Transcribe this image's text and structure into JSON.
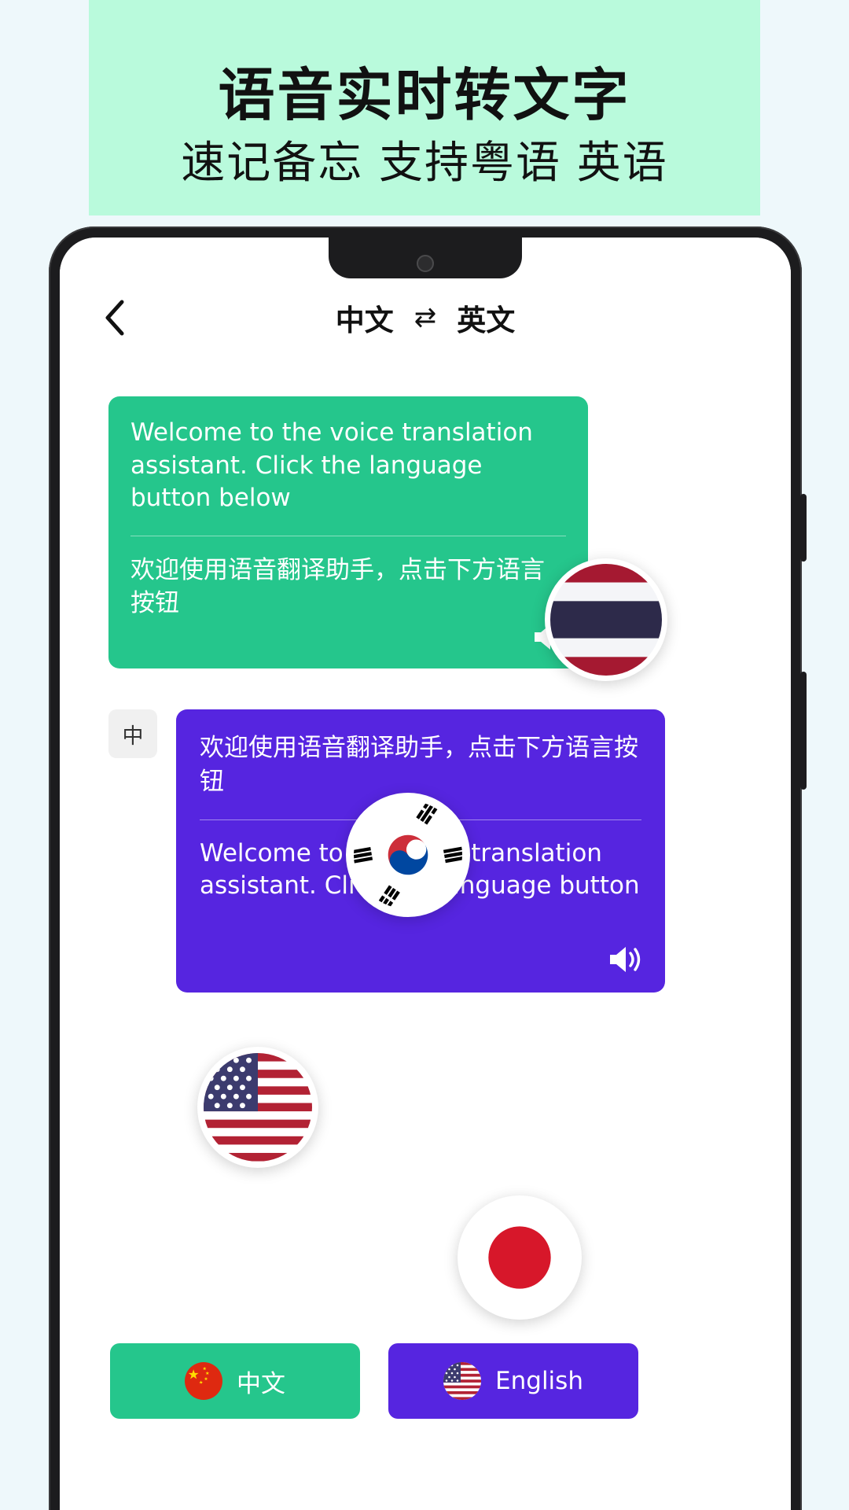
{
  "promo": {
    "title": "语音实时转文字",
    "subtitle": "速记备忘 支持粤语 英语"
  },
  "app": {
    "appbar": {
      "back_icon": "chevron-left-icon",
      "source_language": "中文",
      "swap_icon": "⇄",
      "target_language": "英文"
    },
    "messages": [
      {
        "role": "assistant",
        "color": "#25c68c",
        "primary_text": "Welcome to the voice translation assistant. Click the language button below",
        "secondary_text": "欢迎使用语音翻译助手，点击下方语言按钮",
        "speaker_icon": "speaker-icon"
      },
      {
        "role": "user",
        "color": "#5625e0",
        "avatar_label": "中",
        "primary_text": "欢迎使用语音翻译助手，点击下方语言按钮",
        "secondary_text": "Welcome to the voice translation assistant. Click the language button",
        "speaker_icon": "speaker-icon"
      }
    ],
    "language_buttons": [
      {
        "label": "中文",
        "flag": "flag-cn-icon",
        "color": "#25c68c"
      },
      {
        "label": "English",
        "flag": "flag-us-icon",
        "color": "#5625e0"
      }
    ]
  },
  "floating_flags": [
    {
      "name": "flag-th-icon",
      "country": "Thailand"
    },
    {
      "name": "flag-kr-icon",
      "country": "South Korea"
    },
    {
      "name": "flag-us-icon",
      "country": "United States"
    },
    {
      "name": "flag-jp-icon",
      "country": "Japan"
    }
  ],
  "colors": {
    "promo_bg": "#b9fadc",
    "page_bg": "#eef8fb",
    "accent_green": "#25c68c",
    "accent_purple": "#5625e0"
  }
}
